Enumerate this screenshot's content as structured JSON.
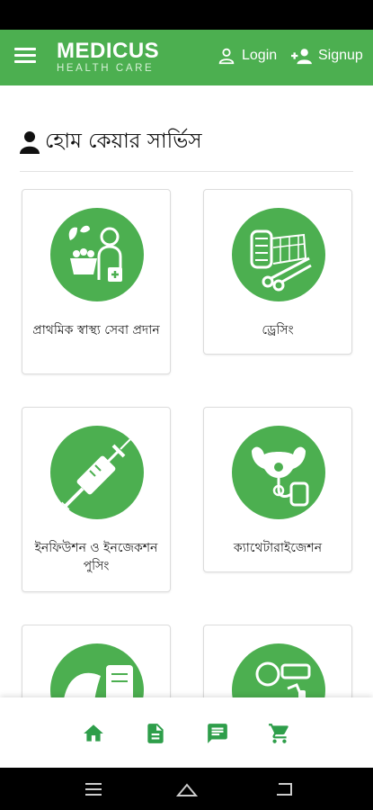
{
  "brand": {
    "name": "MEDICUS",
    "tagline": "HEALTH CARE"
  },
  "header": {
    "login_label": "Login",
    "signup_label": "Signup"
  },
  "page": {
    "title": "হোম কেয়ার সার্ভিস"
  },
  "services": [
    {
      "label": "প্রাথমিক স্বাস্থ্য সেবা প্রদান",
      "icon": "doctor-care-icon"
    },
    {
      "label": "ড্রেসিং",
      "icon": "bandage-scissors-icon"
    },
    {
      "label": "ইনফিউশন ও ইনজেকশন পুসিং",
      "icon": "syringe-icon"
    },
    {
      "label": "ক্যাথেটারাইজেশন",
      "icon": "catheter-icon"
    },
    {
      "label": "",
      "icon": "nebulizer-icon"
    },
    {
      "label": "",
      "icon": "patient-inhaler-icon"
    }
  ],
  "bottom_nav": [
    "home-icon",
    "document-icon",
    "chat-icon",
    "cart-icon"
  ],
  "colors": {
    "primary": "#4caf50",
    "icon_green": "#2e9e4a",
    "status_bar": "#000000"
  }
}
